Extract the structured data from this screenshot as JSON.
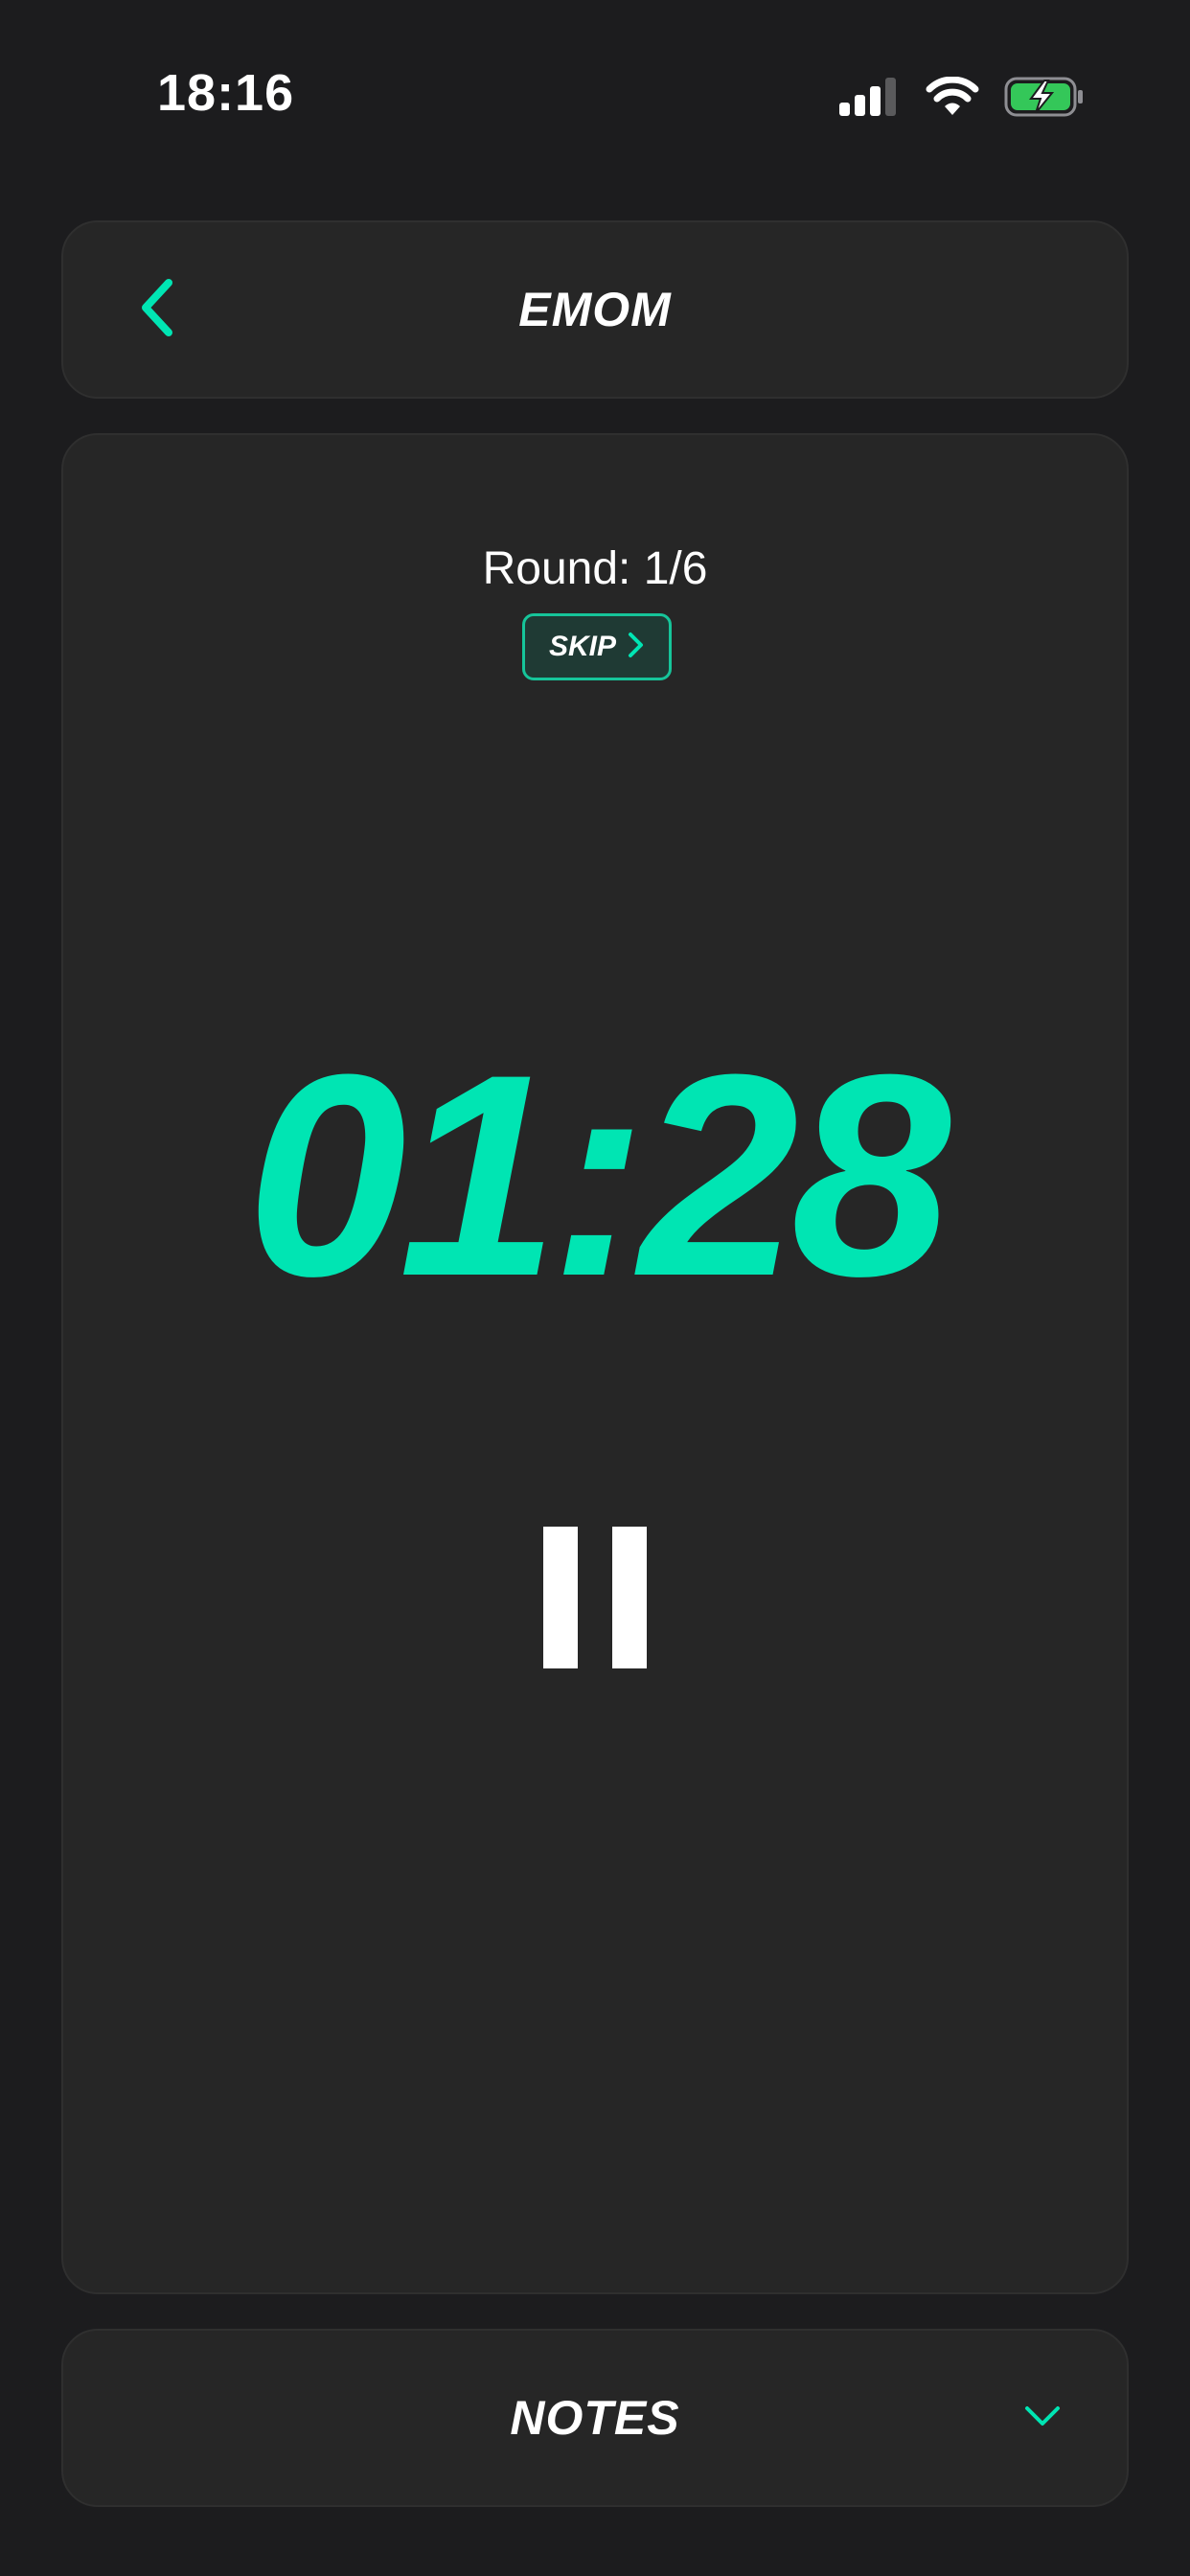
{
  "status_bar": {
    "time": "18:16",
    "icons": [
      "cellular-signal-icon",
      "wifi-icon",
      "battery-charging-icon"
    ]
  },
  "header": {
    "title": "EMOM",
    "back_icon": "chevron-left-icon"
  },
  "workout": {
    "round_label": "Round: 1/6",
    "skip_label": "SKIP",
    "skip_icon": "chevron-right-icon",
    "timer": "01:28",
    "pause_icon": "pause-icon"
  },
  "notes": {
    "title": "NOTES",
    "expand_icon": "chevron-down-icon"
  },
  "colors": {
    "accent": "#00e5b3",
    "background": "#1c1c1e",
    "card": "#262626",
    "text": "#ffffff",
    "battery": "#34c759"
  }
}
